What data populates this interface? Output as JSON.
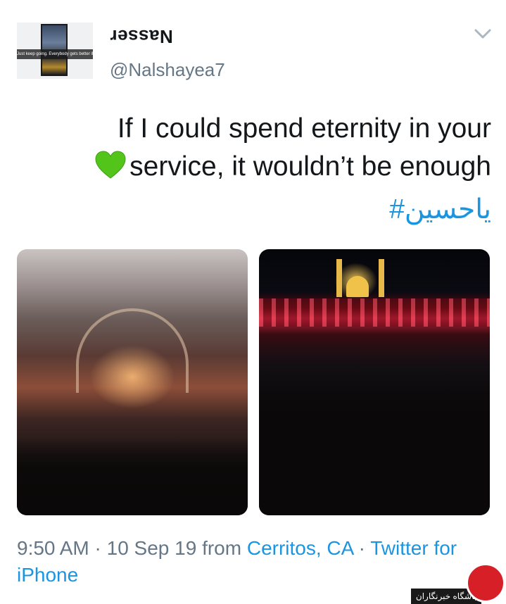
{
  "author": {
    "display_name": "Nasser",
    "handle": "@Nalshayea7",
    "avatar_caption": "Just keep going. Everybody gets better if they keep at it"
  },
  "tweet": {
    "text": "If I could spend eternity in your 💚service, it wouldn’t be enough",
    "text_line1": "If I could spend eternity in your",
    "text_line2": "service, it wouldn’t be enough",
    "hashtag": "#یاحسین"
  },
  "meta": {
    "time": "9:50 AM",
    "sep1": " · ",
    "date": "10 Sep 19",
    "from_label": " from ",
    "location": "Cerritos, CA",
    "sep2": " · ",
    "source": "Twitter for iPhone"
  },
  "watermark": {
    "text": "باشگاه خبرنگاران"
  },
  "icons": {
    "more": "chevron-down-icon",
    "heart": "green-heart-emoji"
  },
  "colors": {
    "link": "#1b95e0",
    "secondary": "#657786",
    "text": "#14171a",
    "heart": "#52c41a"
  }
}
